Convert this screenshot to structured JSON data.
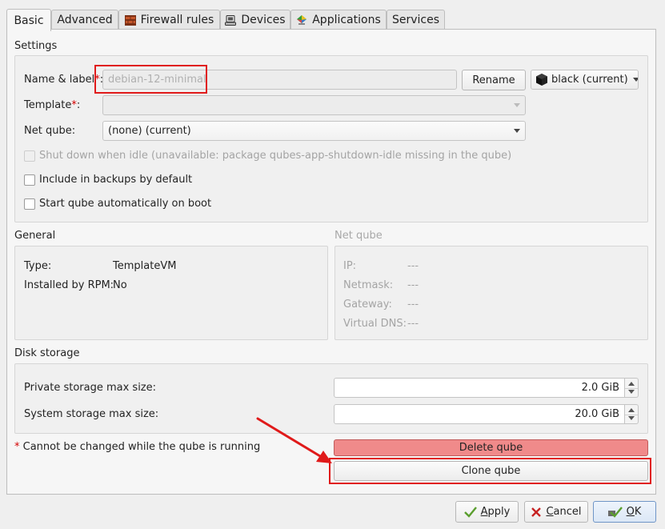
{
  "tabs": [
    {
      "label": "Basic",
      "icon": ""
    },
    {
      "label": "Advanced",
      "icon": ""
    },
    {
      "label": "Firewall rules",
      "icon": "firewall-icon"
    },
    {
      "label": "Devices",
      "icon": "devices-icon"
    },
    {
      "label": "Applications",
      "icon": "applications-icon"
    },
    {
      "label": "Services",
      "icon": ""
    }
  ],
  "settings": {
    "title": "Settings",
    "name_label": "Name & label",
    "name_required": "*",
    "name_suffix": ":",
    "name_value": "debian-12-minimal",
    "rename_button": "Rename",
    "label_value": "black (current)",
    "template_label": "Template",
    "template_required": "*",
    "template_suffix": ":",
    "template_value": "",
    "netqube_label": "Net qube:",
    "netqube_value": "(none) (current)",
    "shutdown_idle": "Shut down when idle (unavailable: package qubes-app-shutdown-idle missing in the qube)",
    "include_backups": "Include in backups by default",
    "start_on_boot": "Start qube automatically on boot"
  },
  "general": {
    "title": "General",
    "type_label": "Type:",
    "type_value": "TemplateVM",
    "rpm_label": "Installed by RPM:",
    "rpm_value": "No"
  },
  "netqube_info": {
    "title": "Net qube",
    "ip_label": "IP:",
    "ip_value": "---",
    "netmask_label": "Netmask:",
    "netmask_value": "---",
    "gateway_label": "Gateway:",
    "gateway_value": "---",
    "dns_label": "Virtual DNS:",
    "dns_value": "---"
  },
  "disk": {
    "title": "Disk storage",
    "private_label": "Private storage max size:",
    "private_value": "2.0 GiB",
    "system_label": "System storage max size:",
    "system_value": "20.0 GiB"
  },
  "footer_note": {
    "asterisk": "*",
    "text": "Cannot be changed while the qube is running"
  },
  "actions": {
    "delete": "Delete qube",
    "clone": "Clone qube"
  },
  "dialog": {
    "apply_prefix": "",
    "apply_mnemonic": "A",
    "apply_rest": "pply",
    "cancel_mnemonic": "C",
    "cancel_rest": "ancel",
    "ok_mnemonic": "O",
    "ok_rest": "K"
  },
  "colors": {
    "label_black": "#111111",
    "delete_bg": "#f08a8a",
    "highlight_red": "#e01a1a"
  }
}
